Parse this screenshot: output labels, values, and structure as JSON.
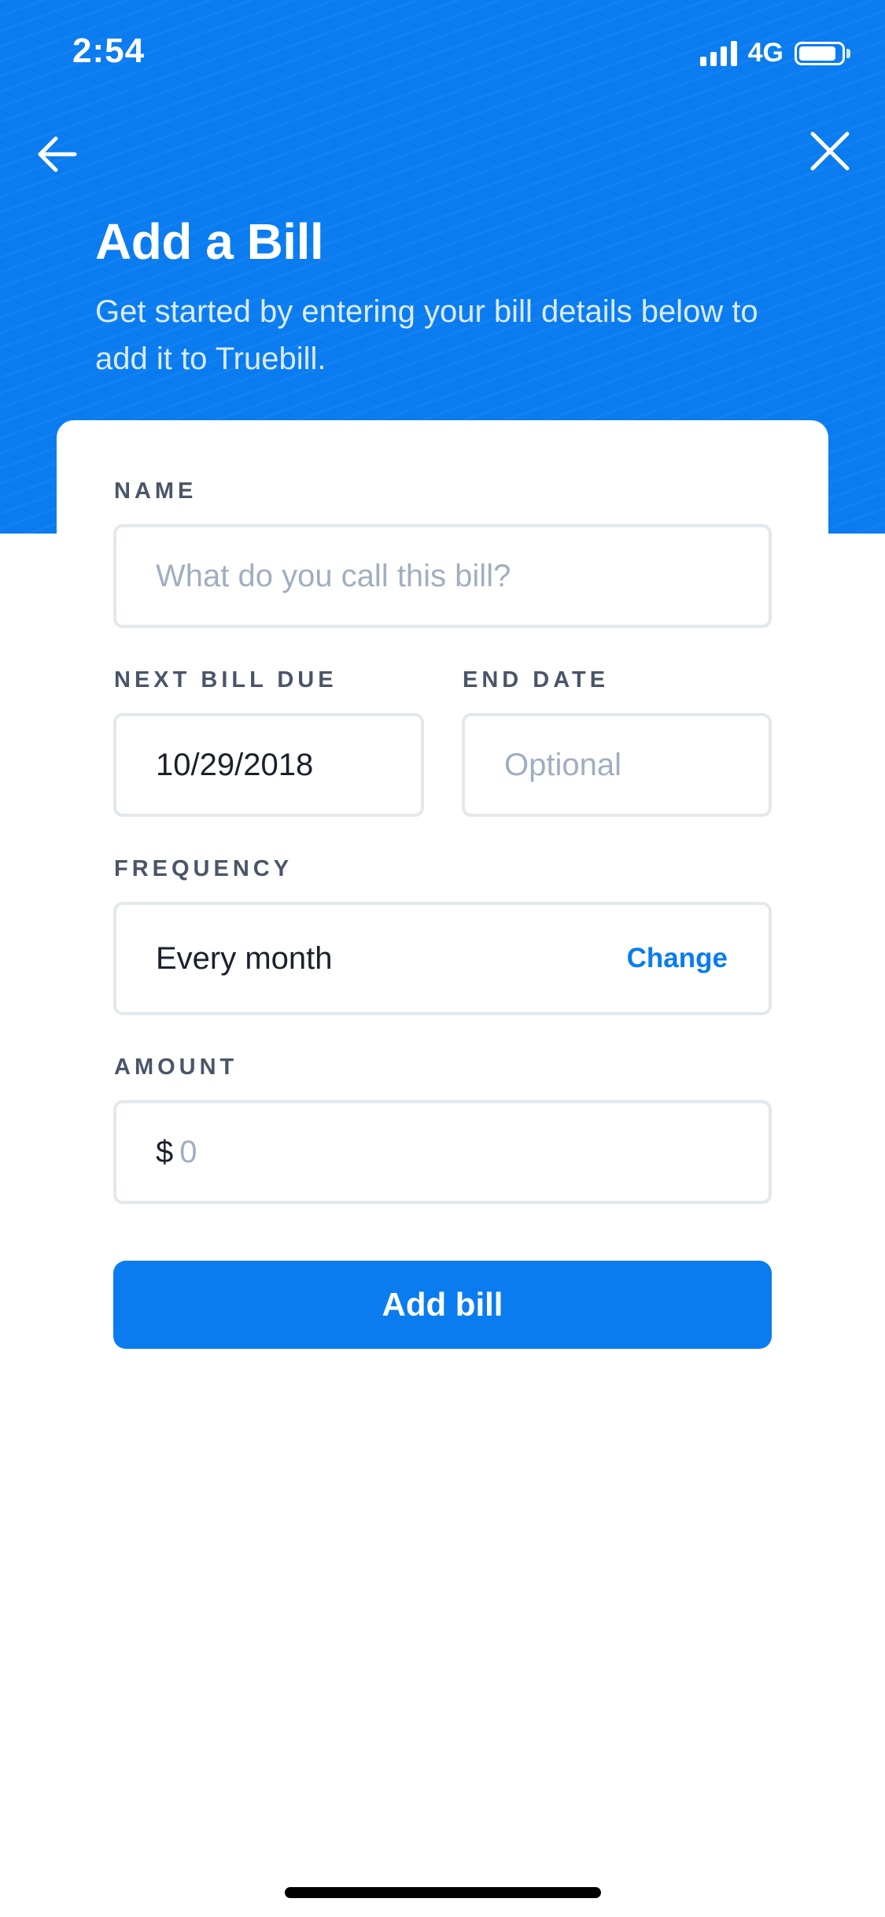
{
  "status_bar": {
    "time": "2:54",
    "network": "4G",
    "battery_level": 0.8,
    "signal_bars": 4
  },
  "header": {
    "back_icon": "arrow-left-icon",
    "close_icon": "close-icon",
    "title": "Add a Bill",
    "subtitle": "Get started by entering your bill details below to add it to Truebill."
  },
  "form": {
    "name": {
      "label": "NAME",
      "placeholder": "What do you call this bill?",
      "value": ""
    },
    "next_bill_due": {
      "label": "NEXT BILL DUE",
      "value": "10/29/2018"
    },
    "end_date": {
      "label": "END DATE",
      "placeholder": "Optional",
      "value": ""
    },
    "frequency": {
      "label": "FREQUENCY",
      "value": "Every month",
      "change_label": "Change"
    },
    "amount": {
      "label": "AMOUNT",
      "currency_symbol": "$",
      "placeholder": "0"
    },
    "submit_label": "Add bill"
  },
  "colors": {
    "brand_blue": "#0a7cf0",
    "label_gray": "#4a5568",
    "placeholder_gray": "#a0aec0",
    "border_gray": "#e3e8ec"
  }
}
